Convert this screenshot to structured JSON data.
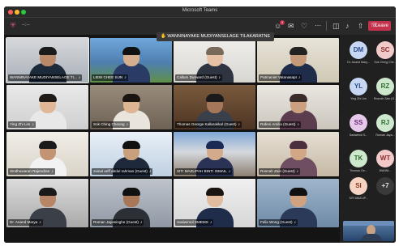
{
  "window": {
    "title": "Microsoft Teams"
  },
  "toolbar": {
    "timer": "--:--",
    "leave_label": "Leave",
    "participant_badge": "3"
  },
  "spotlight": {
    "name": "WANNINAYAKE MUDIYANSELAGE TILAKARATNE"
  },
  "tiles": [
    {
      "name": "WANNINAYAKE MUDIYANSELAGE TI..."
    },
    {
      "name": "LIEW CHEE SUN"
    },
    {
      "name": "Callum Durward (Guest)"
    },
    {
      "name": "Patmaniet Vatanasapt"
    },
    {
      "name": "Ying Zhi Lim"
    },
    {
      "name": "Sok Ching Cheong"
    },
    {
      "name": "Thomas George Kallarakkal (Guest)"
    },
    {
      "name": "Rafeni Amilia (Guest)"
    },
    {
      "name": "Sindhuwaran Rajendran"
    },
    {
      "name": "zainal ariff abdul rahman (Guest)"
    },
    {
      "name": "SITI MAZLIPAH BINTI ISMAIL"
    },
    {
      "name": "Rosnah Zain (Guest)"
    },
    {
      "name": "Dr. Anand Marya"
    },
    {
      "name": "Roman Jayasinghe (Guest)"
    },
    {
      "name": "Sasiwimol SMEMS"
    },
    {
      "name": "Felix Wong (Guest)"
    }
  ],
  "sidebar": {
    "avatars": [
      {
        "initials": "DM",
        "name": "Dr. Anand Mary...",
        "bg": "#c7d6f2",
        "fg": "#2c4a8a"
      },
      {
        "initials": "SC",
        "name": "Sok Ching Che...",
        "bg": "#f2c9c9",
        "fg": "#8a2c2c"
      },
      {
        "initials": "YL",
        "name": "Ying Zhi Lim",
        "bg": "#c7d6f2",
        "fg": "#2c4a8a"
      },
      {
        "initials": "RZ",
        "name": "Rosnah Zain (G...",
        "bg": "#cde8cd",
        "fg": "#2e6b2e"
      },
      {
        "initials": "SS",
        "name": "Sasiwimol S...",
        "bg": "#e6c8ea",
        "fg": "#6b2c77"
      },
      {
        "initials": "RJ",
        "name": "Roman Jaya...",
        "bg": "#cde8cd",
        "fg": "#2e6b2e"
      },
      {
        "initials": "TK",
        "name": "Thomas Ge...",
        "bg": "#cde8cd",
        "fg": "#2e6b2e"
      },
      {
        "initials": "WT",
        "name": "WANNI...",
        "bg": "#f2c9c9",
        "fg": "#8a2c2c"
      },
      {
        "initials": "SI",
        "name": "SITI MAZLIP...",
        "bg": "#f6d3c2",
        "fg": "#8a3a1c"
      },
      {
        "initials": "+7",
        "name": "",
        "bg": "#3a3a3a",
        "fg": "#e0e0e0"
      }
    ]
  }
}
